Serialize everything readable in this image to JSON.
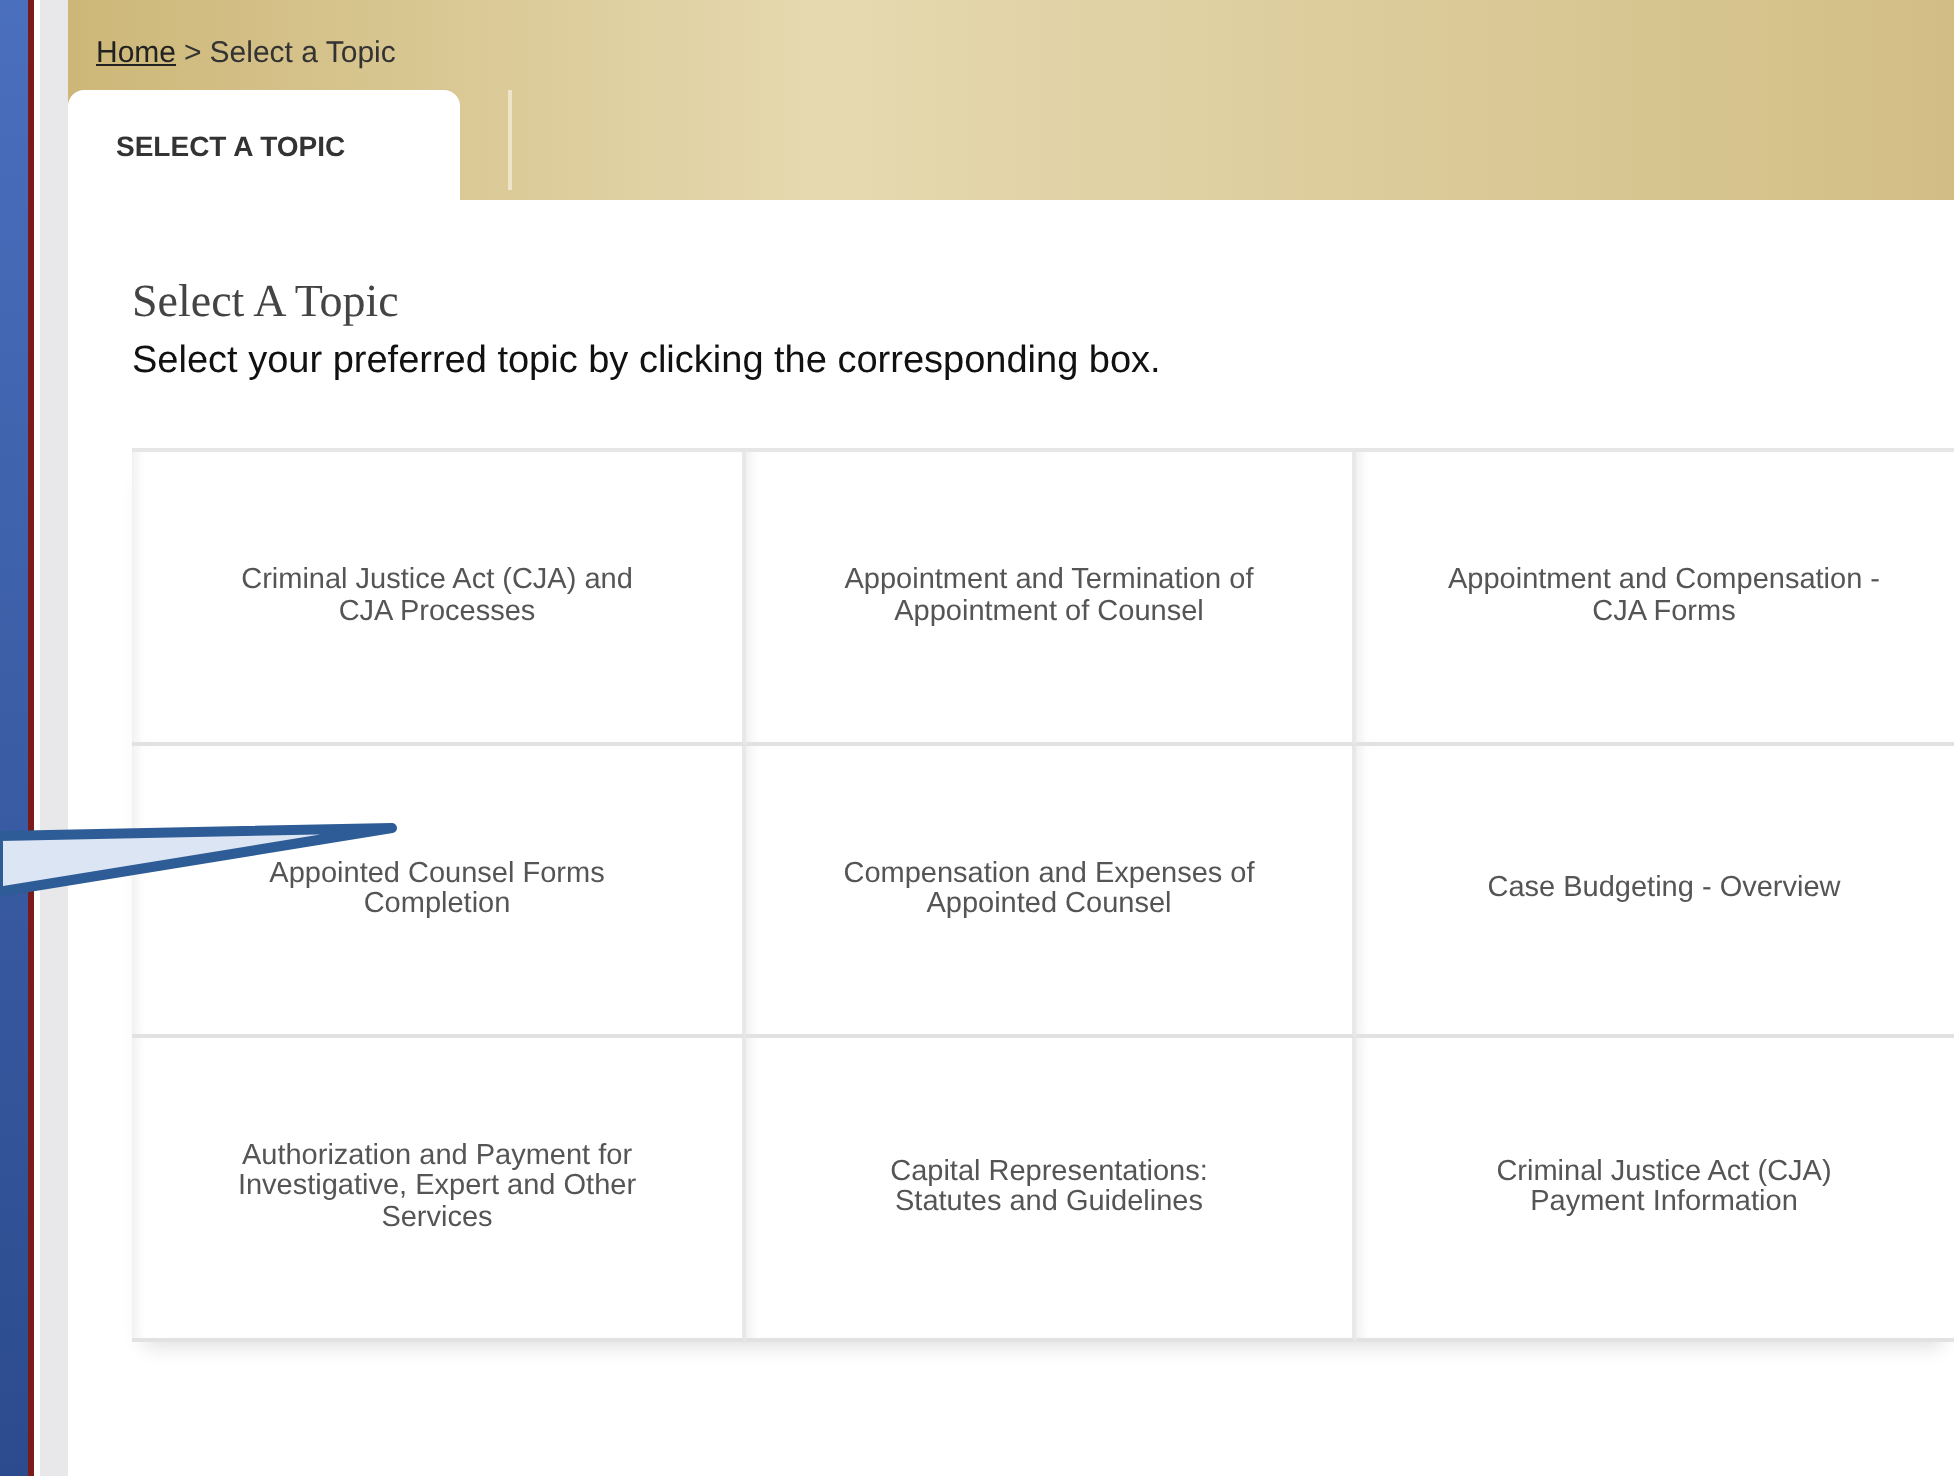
{
  "breadcrumb": {
    "link": "Home",
    "separator": ">",
    "current": "Select a Topic"
  },
  "tabs": [
    {
      "label": "SELECT A TOPIC",
      "selected": true
    }
  ],
  "heading": "Select A Topic",
  "instruction": "Select your preferred topic by clicking the corresponding box.",
  "topics": [
    {
      "label": "Criminal Justice Act (CJA) and CJA Processes"
    },
    {
      "label": "Appointment and Termination of Appointment of Counsel"
    },
    {
      "label": "Appointment and Compensation - CJA Forms"
    },
    {
      "label": "Appointed Counsel Forms Completion"
    },
    {
      "label": "Compensation and Expenses of Appointed Counsel"
    },
    {
      "label": "Case Budgeting - Overview"
    },
    {
      "label": "Authorization and Payment for Investigative, Expert and Other Services"
    },
    {
      "label": "Capital Representations: Statutes and Guidelines"
    },
    {
      "label": "Criminal Justice Act (CJA) Payment Information"
    }
  ]
}
